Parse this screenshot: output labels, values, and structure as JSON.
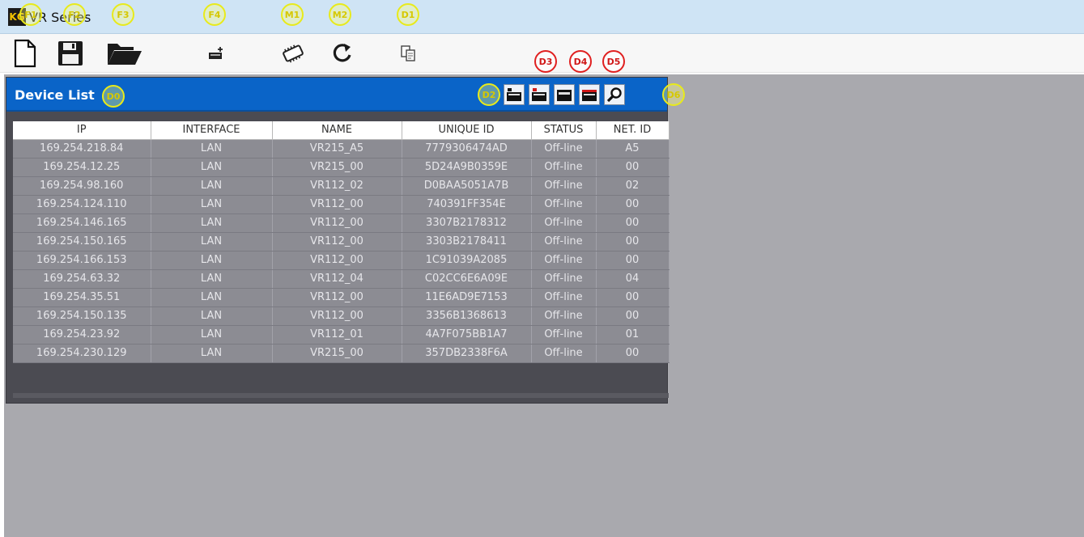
{
  "titlebar": {
    "app_icon": "app-logo-icon",
    "app_title": "VR Series",
    "logo_text": "KG"
  },
  "toolbar": {
    "buttons": [
      {
        "name": "new-file",
        "icon": "new-file-icon",
        "badge": "F1"
      },
      {
        "name": "save-file",
        "icon": "floppy-disk-icon",
        "badge": "F2"
      },
      {
        "name": "open-folder",
        "icon": "open-folder-icon",
        "badge": "F3"
      },
      {
        "name": "add-device",
        "icon": "add-device-icon",
        "badge": "F4"
      },
      {
        "name": "firmware",
        "icon": "chip-icon",
        "badge": "M1"
      },
      {
        "name": "refresh",
        "icon": "refresh-icon",
        "badge": "M2"
      },
      {
        "name": "copy",
        "icon": "copy-icon",
        "badge": "D1"
      }
    ]
  },
  "device_list": {
    "title": "Device List",
    "title_badge": "D0",
    "header_badges": {
      "d2": "D2",
      "d3": "D3",
      "d4": "D4",
      "d5": "D5",
      "d6": "D6"
    },
    "header_buttons": [
      {
        "name": "device-tool-1",
        "icon": "window-add-icon"
      },
      {
        "name": "device-tool-2",
        "icon": "window-remove-icon"
      },
      {
        "name": "device-tool-3",
        "icon": "window-icon"
      },
      {
        "name": "device-tool-4",
        "icon": "window-red-icon"
      },
      {
        "name": "device-search",
        "icon": "search-icon"
      }
    ],
    "columns": [
      "IP",
      "INTERFACE",
      "NAME",
      "UNIQUE ID",
      "STATUS",
      "NET. ID"
    ],
    "rows": [
      [
        "169.254.218.84",
        "LAN",
        "VR215_A5",
        "7779306474AD",
        "Off-line",
        "A5"
      ],
      [
        "169.254.12.25",
        "LAN",
        "VR215_00",
        "5D24A9B0359E",
        "Off-line",
        "00"
      ],
      [
        "169.254.98.160",
        "LAN",
        "VR112_02",
        "D0BAA5051A7B",
        "Off-line",
        "02"
      ],
      [
        "169.254.124.110",
        "LAN",
        "VR112_00",
        "740391FF354E",
        "Off-line",
        "00"
      ],
      [
        "169.254.146.165",
        "LAN",
        "VR112_00",
        "3307B2178312",
        "Off-line",
        "00"
      ],
      [
        "169.254.150.165",
        "LAN",
        "VR112_00",
        "3303B2178411",
        "Off-line",
        "00"
      ],
      [
        "169.254.166.153",
        "LAN",
        "VR112_00",
        "1C91039A2085",
        "Off-line",
        "00"
      ],
      [
        "169.254.63.32",
        "LAN",
        "VR112_04",
        "C02CC6E6A09E",
        "Off-line",
        "04"
      ],
      [
        "169.254.35.51",
        "LAN",
        "VR112_00",
        "11E6AD9E7153",
        "Off-line",
        "00"
      ],
      [
        "169.254.150.135",
        "LAN",
        "VR112_00",
        "3356B1368613",
        "Off-line",
        "00"
      ],
      [
        "169.254.23.92",
        "LAN",
        "VR112_01",
        "4A7F075BB1A7",
        "Off-line",
        "01"
      ],
      [
        "169.254.230.129",
        "LAN",
        "VR215_00",
        "357DB2338F6A",
        "Off-line",
        "00"
      ]
    ]
  },
  "colors": {
    "header_blue": "#0a64c8",
    "row_grey": "#8c8c93",
    "workspace": "#a9a9ae"
  }
}
